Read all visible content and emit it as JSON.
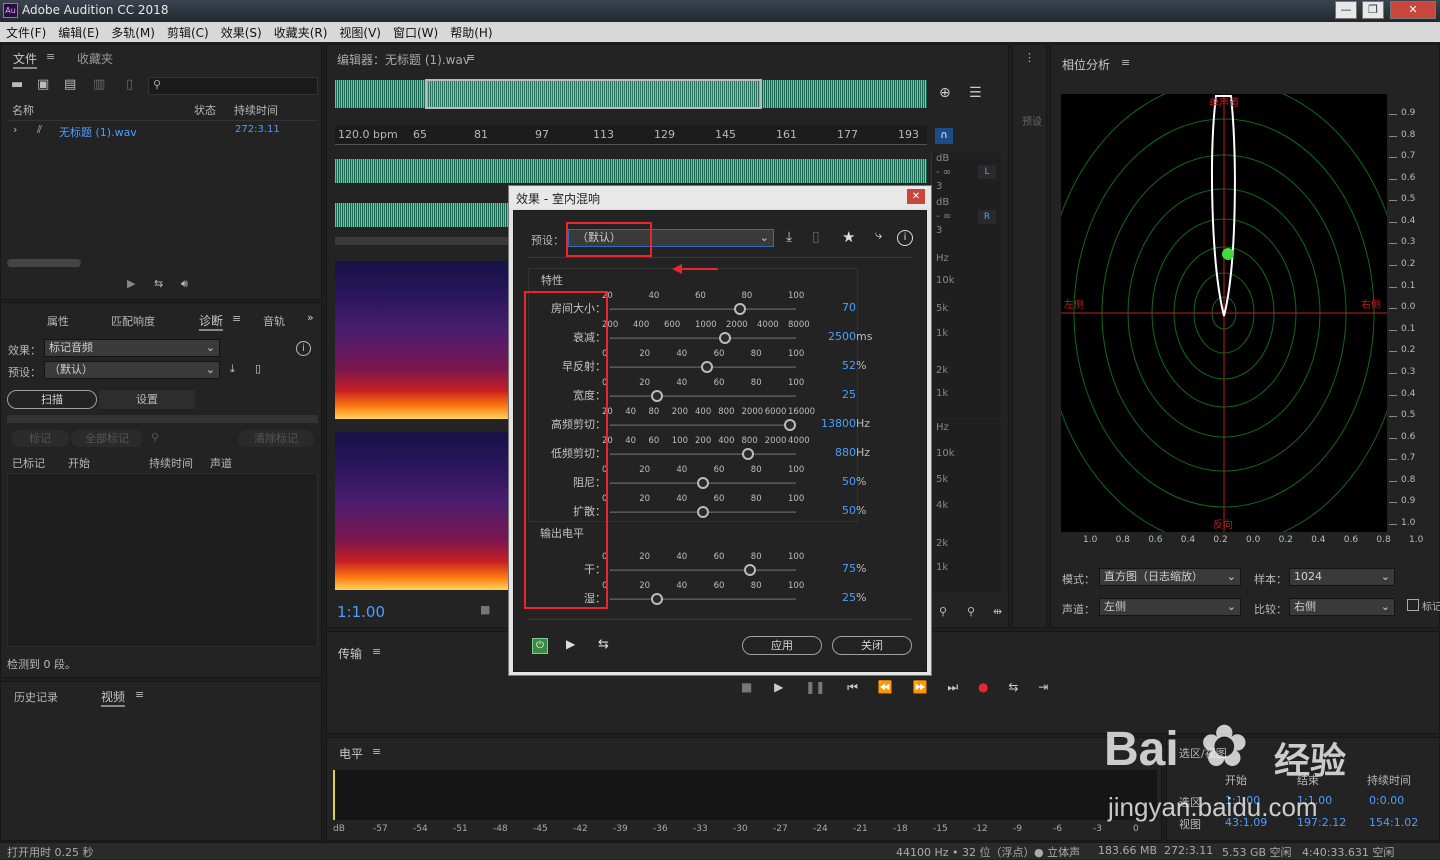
{
  "app": {
    "title": "Adobe Audition CC 2018",
    "icon_text": "Au"
  },
  "menu": [
    "文件(F)",
    "编辑(E)",
    "多轨(M)",
    "剪辑(C)",
    "效果(S)",
    "收藏夹(R)",
    "视图(V)",
    "窗口(W)",
    "帮助(H)"
  ],
  "files_panel": {
    "tabs": [
      "文件",
      "收藏夹"
    ],
    "cols": [
      "名称",
      "状态",
      "持续时间"
    ],
    "file": {
      "name": "无标题 (1).wav",
      "duration": "272:3.11"
    }
  },
  "diag_panel": {
    "tabs": [
      "属性",
      "匹配响度",
      "诊断",
      "音轨"
    ],
    "effect_label": "效果：",
    "effect_value": "标记音频",
    "preset_label": "预设：",
    "preset_value": "（默认）",
    "scan": "扫描",
    "settings": "设置",
    "mark": "标记",
    "mark_all": "全部标记",
    "clear_marks": "清除标记",
    "cols": [
      "已标记",
      "开始",
      "持续时间",
      "声道"
    ],
    "status": "检测到 0 段。"
  },
  "history_panel": {
    "tabs": [
      "历史记录",
      "视频"
    ]
  },
  "editor": {
    "title": "编辑器：无标题 (1).wav",
    "ruler": [
      "120.0 bpm",
      "65",
      "81",
      "97",
      "113",
      "129",
      "145",
      "161",
      "177",
      "193"
    ],
    "zoom": "1:1.00",
    "db": [
      "dB",
      "- ∞",
      "3",
      "dB",
      "- ∞",
      "3"
    ],
    "hz": [
      "Hz",
      "10k",
      "5k",
      "1k",
      "2k",
      "1k",
      "Hz",
      "10k",
      "5k",
      "4k",
      "2k",
      "1k"
    ],
    "ch": [
      "L",
      "R"
    ],
    "preset_side": "预设"
  },
  "transport": {
    "title": "传输"
  },
  "levels": {
    "title": "电平",
    "scale": [
      "dB",
      "-57",
      "-54",
      "-51",
      "-48",
      "-45",
      "-42",
      "-39",
      "-36",
      "-33",
      "-30",
      "-27",
      "-24",
      "-21",
      "-18",
      "-15",
      "-12",
      "-9",
      "-6",
      "-3",
      "0"
    ]
  },
  "phase": {
    "title": "相位分析",
    "labels": {
      "top": "单声道",
      "left": "左侧",
      "right": "右侧",
      "bottom": "反向"
    },
    "right_scale": [
      "0.9",
      "0.8",
      "0.7",
      "0.6",
      "0.5",
      "0.4",
      "0.3",
      "0.2",
      "0.1",
      "0.0",
      "0.1",
      "0.2",
      "0.3",
      "0.4",
      "0.5",
      "0.6",
      "0.7",
      "0.8",
      "0.9",
      "1.0"
    ],
    "bottom_scale": [
      "1.0",
      "0.8",
      "0.6",
      "0.4",
      "0.2",
      "0.0",
      "0.2",
      "0.4",
      "0.6",
      "0.8",
      "1.0"
    ],
    "mode_label": "模式：",
    "mode": "直方图（日志缩放）",
    "sample_label": "样本：",
    "sample": "1024",
    "channel_label": "声道：",
    "channel": "左侧",
    "compare_label": "比较：",
    "compare": "右侧",
    "mark_label": "标记"
  },
  "selection": {
    "title": "选区/视图",
    "cols": [
      "开始",
      "结束",
      "持续时间"
    ],
    "rows": [
      {
        "label": "选区",
        "start": "1:1.00",
        "end": "1:1.00",
        "dur": "0:0.00"
      },
      {
        "label": "视图",
        "start": "43:1.09",
        "end": "197:2.12",
        "dur": "154:1.02"
      }
    ]
  },
  "watermark": {
    "brand": "Bai",
    "mid": "经验",
    "url": "jingyan.baidu.com"
  },
  "dialog": {
    "title": "效果 - 室内混响",
    "preset_label": "预设：",
    "preset_value": "（默认）",
    "section1": "特性",
    "section2": "输出电平",
    "apply": "应用",
    "close": "关闭",
    "params": [
      {
        "label": "房间大小：",
        "ticks": [
          "20",
          "40",
          "60",
          "80",
          "100"
        ],
        "value": "70",
        "unit": "",
        "pos": 0.7
      },
      {
        "label": "衰减：",
        "ticks": [
          "200",
          "400",
          "600",
          "1000",
          "2000",
          "4000",
          "8000"
        ],
        "value": "2500",
        "unit": "ms",
        "pos": 0.62
      },
      {
        "label": "早反射：",
        "ticks": [
          "0",
          "20",
          "40",
          "60",
          "80",
          "100"
        ],
        "value": "52",
        "unit": "%",
        "pos": 0.52
      },
      {
        "label": "宽度：",
        "ticks": [
          "0",
          "20",
          "40",
          "60",
          "80",
          "100"
        ],
        "value": "25",
        "unit": "",
        "pos": 0.25
      },
      {
        "label": "高频剪切：",
        "ticks": [
          "20",
          "40",
          "80",
          "200",
          "400",
          "800",
          "2000",
          "6000",
          "16000"
        ],
        "value": "13800",
        "unit": "Hz",
        "pos": 0.97
      },
      {
        "label": "低频剪切：",
        "ticks": [
          "20",
          "40",
          "60",
          "100",
          "200",
          "400",
          "800",
          "2000",
          "4000"
        ],
        "value": "880",
        "unit": "Hz",
        "pos": 0.74
      },
      {
        "label": "阻尼：",
        "ticks": [
          "0",
          "20",
          "40",
          "60",
          "80",
          "100"
        ],
        "value": "50",
        "unit": "%",
        "pos": 0.5
      },
      {
        "label": "扩散：",
        "ticks": [
          "0",
          "20",
          "40",
          "60",
          "80",
          "100"
        ],
        "value": "50",
        "unit": "%",
        "pos": 0.5
      }
    ],
    "outputs": [
      {
        "label": "干：",
        "ticks": [
          "0",
          "20",
          "40",
          "60",
          "80",
          "100"
        ],
        "value": "75",
        "unit": "%",
        "pos": 0.75
      },
      {
        "label": "湿：",
        "ticks": [
          "0",
          "20",
          "40",
          "60",
          "80",
          "100"
        ],
        "value": "25",
        "unit": "%",
        "pos": 0.25
      }
    ]
  },
  "status": {
    "left": "打开用时 0.25 秒",
    "items": [
      "44100 Hz • 32 位（浮点）",
      "● 立体声",
      "183.66 MB",
      "272:3.11",
      "5.53 GB 空闲",
      "4:40:33.631 空闲"
    ]
  },
  "colors": {
    "accent": "#4a9fff",
    "highlight": "#e8262c",
    "wave": "#3dd6a0"
  }
}
